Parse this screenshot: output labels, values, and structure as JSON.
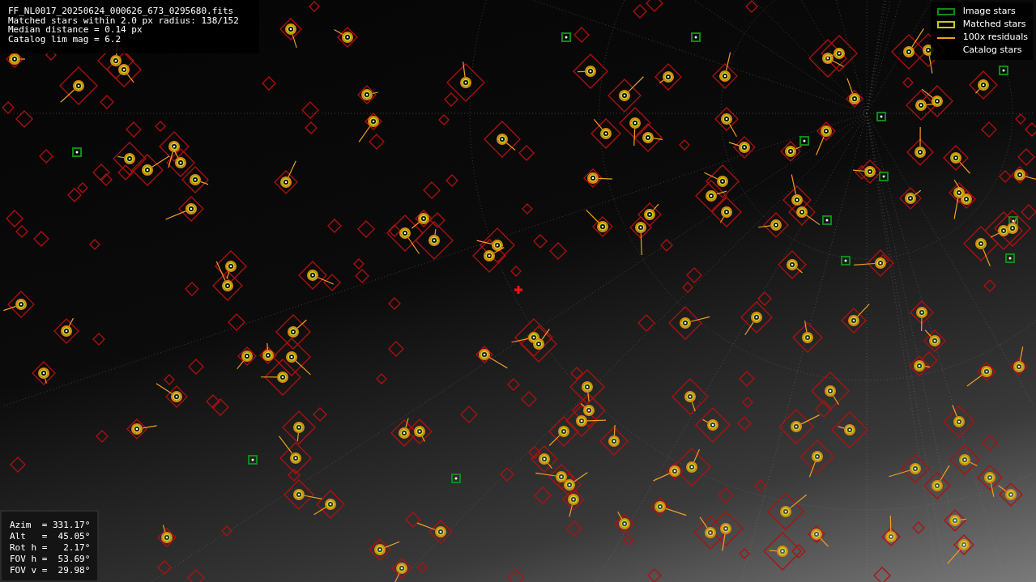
{
  "info_panel": {
    "lines": [
      "FF_NL0017_20250624_000626_673_0295680.fits",
      "Matched stars within 2.0 px radius: 138/152",
      "Median distance = 0.14 px",
      "Catalog lim mag = 6.2"
    ]
  },
  "legend": {
    "items": [
      {
        "label": "Image stars",
        "kind": "box",
        "color": "#0f8a1a"
      },
      {
        "label": "Matched stars",
        "kind": "box",
        "color": "#c8c81e"
      },
      {
        "label": "100x residuals",
        "kind": "line",
        "color": "#f0a020"
      },
      {
        "label": "Catalog stars",
        "kind": "blank"
      }
    ]
  },
  "pointing_panel": {
    "lines": [
      "Azim  = 331.17°",
      "Alt   =  45.05°",
      "Rot h =   2.17°",
      "FOV h =  53.69°",
      "FOV v =  29.98°"
    ]
  }
}
